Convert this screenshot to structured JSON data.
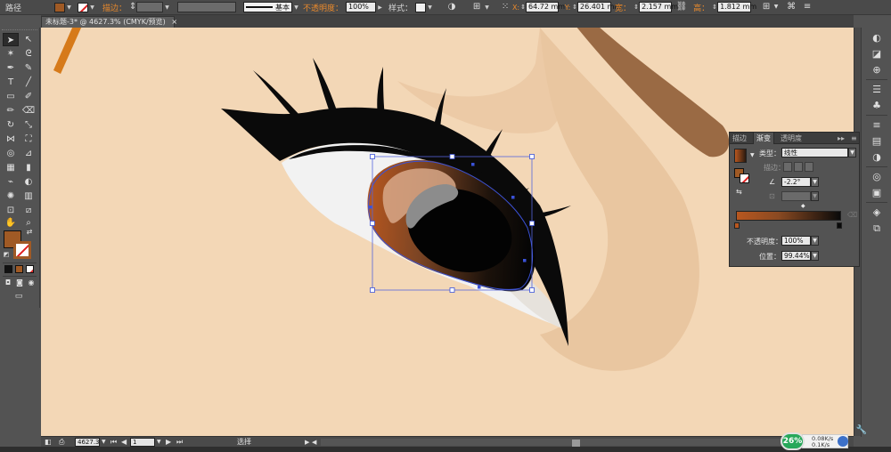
{
  "control_bar": {
    "object_type": "路径",
    "stroke_label": "描边：",
    "brush_label": "基本",
    "opacity_label": "不透明度：",
    "opacity_value": "100%",
    "style_label": "样式：",
    "x_label": "X:",
    "x_value": "64.72 mm",
    "y_label": "Y:",
    "y_value": "26.401 mm",
    "w_label": "宽：",
    "w_value": "2.157 mm",
    "h_label": "高：",
    "h_value": "1.812 mm",
    "fill_color": "#a05a25"
  },
  "document_tab": {
    "title": "未标题-3* @ 4627.3% (CMYK/预览)",
    "close_glyph": "×"
  },
  "toolbar": {
    "tools": [
      "selection",
      "direct-selection",
      "magic-wand",
      "lasso",
      "pen",
      "curvature",
      "type",
      "line-segment",
      "rectangle",
      "paintbrush",
      "pencil",
      "eraser",
      "rotate",
      "scale",
      "width",
      "free-transform",
      "shape-builder",
      "perspective-grid",
      "mesh",
      "gradient",
      "eyedropper",
      "blend",
      "symbol-sprayer",
      "column-graph",
      "artboard",
      "slice",
      "hand",
      "zoom"
    ],
    "fill_color": "#a05a25"
  },
  "status_bar": {
    "zoom": "4627.3",
    "artboard": "1",
    "tool": "选择"
  },
  "gradient_panel": {
    "tabs": [
      "描边",
      "渐变",
      "透明度"
    ],
    "active_tab": "渐变",
    "type_label": "类型：",
    "type_value": "线性",
    "stroke_label": "描边：",
    "angle_value": "-2.2°",
    "opacity_label": "不透明度：",
    "opacity_value": "100%",
    "location_label": "位置：",
    "location_value": "99.44%",
    "gradient_colors": [
      "#b8571f",
      "#0a0a0a"
    ]
  },
  "network_badge": {
    "percent": "26%",
    "upload": "0.08K/s",
    "download": "0.1K/s"
  },
  "colors": {
    "skin": "#f3d7b6",
    "accent": "#e8892c",
    "iris_brown": "#a05a25",
    "eyebrow": "#9a6a44"
  }
}
